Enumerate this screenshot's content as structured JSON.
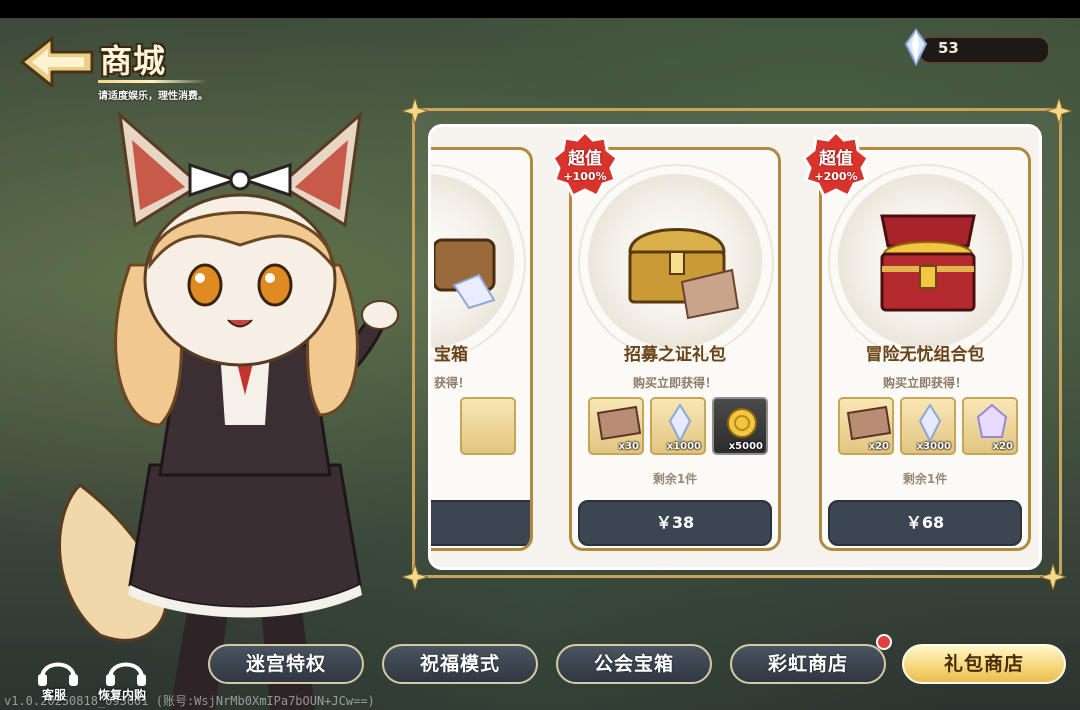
{
  "header": {
    "title": "商城",
    "subtitle": "请适度娱乐，理性消费。",
    "back_icon": "back-arrow-icon"
  },
  "currency": {
    "icon": "crystal-icon",
    "value": "53"
  },
  "shop": {
    "cards": [
      {
        "title": "宝箱",
        "subtitle": "获得！",
        "partial": true
      },
      {
        "badge_line1": "超值",
        "badge_line2": "+100%",
        "title": "招募之证礼包",
        "subtitle": "购买立即获得！",
        "items": [
          {
            "icon": "recruit-ticket-icon",
            "count": "x30"
          },
          {
            "icon": "crystal-icon",
            "count": "x1000"
          },
          {
            "icon": "gold-coin-icon",
            "count": "x5000"
          }
        ],
        "stock": "剩余1件",
        "price": "￥38"
      },
      {
        "badge_line1": "超值",
        "badge_line2": "+200%",
        "title": "冒险无忧组合包",
        "subtitle": "购买立即获得！",
        "items": [
          {
            "icon": "recruit-ticket-icon",
            "count": "x20"
          },
          {
            "icon": "crystal-icon",
            "count": "x3000"
          },
          {
            "icon": "purple-crystal-icon",
            "count": "x20"
          }
        ],
        "stock": "剩余1件",
        "price": "￥68"
      }
    ]
  },
  "nav": {
    "tabs": [
      {
        "label": "迷宫特权",
        "active": false
      },
      {
        "label": "祝福模式",
        "active": false
      },
      {
        "label": "公会宝箱",
        "active": false
      },
      {
        "label": "彩虹商店",
        "active": false,
        "notification": true
      },
      {
        "label": "礼包商店",
        "active": true
      }
    ]
  },
  "footer": {
    "customer_service": "客服",
    "restore_purchase": "恢复内购",
    "version": "v1.0.20250818_093601 (账号:WsjNrMb0XmIPa7bOUN+JCw==)"
  },
  "colors": {
    "accent_gold": "#c9a55a",
    "price_button": "#3c4652",
    "badge_red": "#d8342c",
    "active_tab": "#f6d676"
  }
}
